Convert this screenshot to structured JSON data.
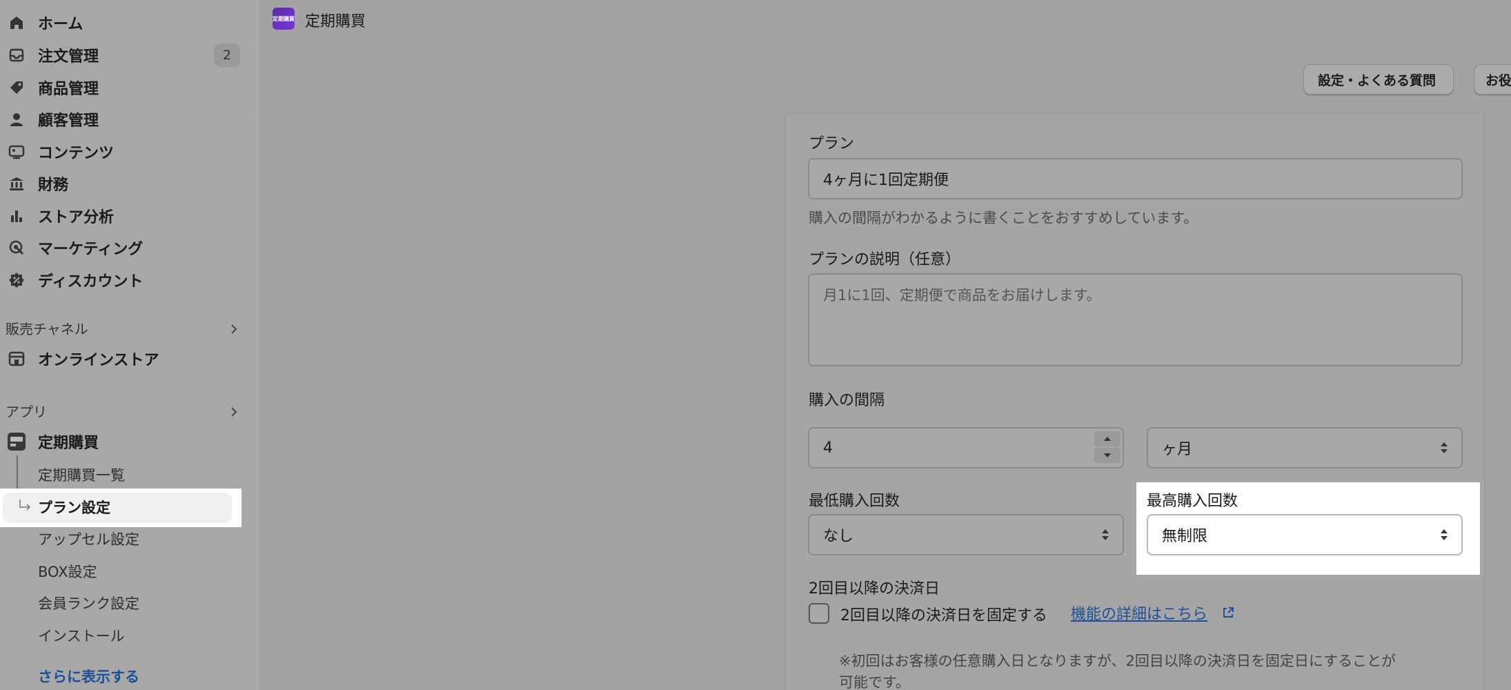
{
  "sidebar": {
    "items": [
      {
        "label": "ホーム",
        "icon": "home-icon"
      },
      {
        "label": "注文管理",
        "icon": "inbox-icon",
        "badge": "2"
      },
      {
        "label": "商品管理",
        "icon": "tag-icon"
      },
      {
        "label": "顧客管理",
        "icon": "person-icon"
      },
      {
        "label": "コンテンツ",
        "icon": "image-icon"
      },
      {
        "label": "財務",
        "icon": "bank-icon"
      },
      {
        "label": "ストア分析",
        "icon": "bar-chart-icon"
      },
      {
        "label": "マーケティング",
        "icon": "target-icon"
      },
      {
        "label": "ディスカウント",
        "icon": "discount-icon"
      }
    ],
    "sales_channels": {
      "label": "販売チャネル",
      "items": [
        {
          "label": "オンラインストア",
          "icon": "store-icon"
        }
      ]
    },
    "apps": {
      "label": "アプリ",
      "app_name": "定期購買",
      "sub_items": [
        "定期購買一覧",
        "プラン設定",
        "アップセル設定",
        "BOX設定",
        "会員ランク設定",
        "インストール"
      ],
      "active_sub_item": "プラン設定"
    },
    "more_link": "さらに表示する"
  },
  "header": {
    "app_icon_text": "定期購買",
    "app_title": "定期購買"
  },
  "toolbar": {
    "settings_faq_button": "設定・よくある質問",
    "help_button": "お役"
  },
  "form": {
    "plan": {
      "label": "プラン",
      "value": "4ヶ月に1回定期便",
      "help": "購入の間隔がわかるように書くことをおすすめしています。"
    },
    "description": {
      "label": "プランの説明（任意）",
      "placeholder": "月1に1回、定期便で商品をお届けします。"
    },
    "interval": {
      "label": "購入の間隔",
      "value": "4",
      "unit": "ヶ月"
    },
    "min_purchases": {
      "label": "最低購入回数",
      "value": "なし"
    },
    "max_purchases": {
      "label": "最高購入回数",
      "value": "無制限"
    },
    "billing_date": {
      "label": "2回目以降の決済日",
      "checkbox_label": "2回目以降の決済日を固定する",
      "checked": false,
      "link": "機能の詳細はこちら",
      "note_line1": "※初回はお客様の任意購入日となりますが、2回目以降の決済日を固定日にすることが",
      "note_line2": "可能です。"
    }
  },
  "colors": {
    "link": "#1d4f98",
    "app_icon": "#6a30c0",
    "highlight": "#ffffff"
  }
}
